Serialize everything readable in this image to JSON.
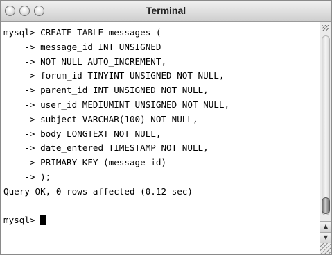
{
  "window": {
    "title": "Terminal",
    "buttons": {
      "close": "close-button",
      "minimize": "minimize-button",
      "zoom": "zoom-button"
    }
  },
  "terminal": {
    "lines": [
      "mysql> CREATE TABLE messages (",
      "    -> message_id INT UNSIGNED",
      "    -> NOT NULL AUTO_INCREMENT,",
      "    -> forum_id TINYINT UNSIGNED NOT NULL,",
      "    -> parent_id INT UNSIGNED NOT NULL,",
      "    -> user_id MEDIUMINT UNSIGNED NOT NULL,",
      "    -> subject VARCHAR(100) NOT NULL,",
      "    -> body LONGTEXT NOT NULL,",
      "    -> date_entered TIMESTAMP NOT NULL,",
      "    -> PRIMARY KEY (message_id)",
      "    -> );",
      "Query OK, 0 rows affected (0.12 sec)",
      "",
      "mysql> "
    ]
  },
  "scrollbar": {
    "up_glyph": "▲",
    "down_glyph": "▼"
  }
}
